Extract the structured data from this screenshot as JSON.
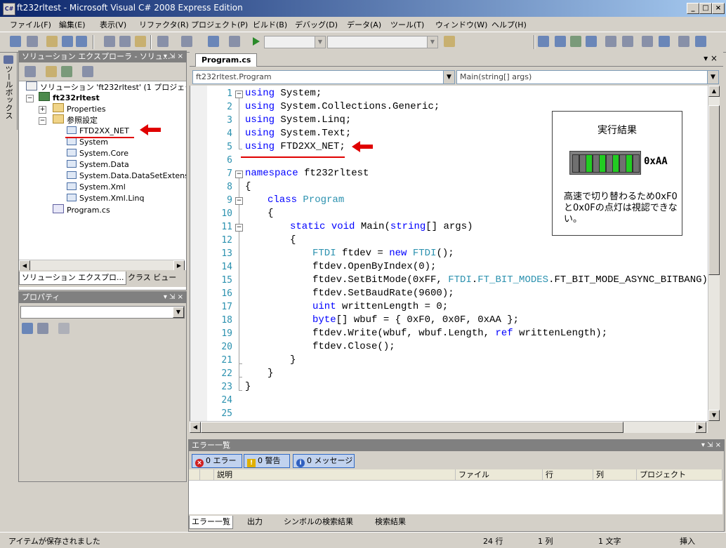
{
  "window": {
    "title": "ft232rltest - Microsoft Visual C# 2008 Express Edition",
    "icon_text": "C#",
    "minimize": "_",
    "maximize": "□",
    "close": "×"
  },
  "menu": [
    "ファイル(F)",
    "編集(E)",
    "表示(V)",
    "リファクタ(R)",
    "プロジェクト(P)",
    "ビルド(B)",
    "デバッグ(D)",
    "データ(A)",
    "ツール(T)",
    "ウィンドウ(W)",
    "ヘルプ(H)"
  ],
  "toolbox_label": "ツールボックス",
  "solution_explorer": {
    "title": "ソリューション エクスプローラ - ソリュ...",
    "header_buttons": "▾ ⇲ ×",
    "tree": {
      "solution": "ソリューション 'ft232rltest' (1 プロジェクト)",
      "project": "ft232rltest",
      "properties": "Properties",
      "references": "参照設定",
      "refs": [
        "FTD2XX_NET",
        "System",
        "System.Core",
        "System.Data",
        "System.Data.DataSetExtensions",
        "System.Xml",
        "System.Xml.Linq"
      ],
      "program_file": "Program.cs"
    },
    "tabs": [
      "ソリューション エクスプロ...",
      "クラス ビュー"
    ]
  },
  "properties_panel": {
    "title": "プロパティ",
    "header_buttons": "▾ ⇲ ×"
  },
  "editor": {
    "tab": "Program.cs",
    "tab_controls": "▾ ×",
    "nav_left": "ft232rltest.Program",
    "nav_right": "Main(string[] args)",
    "line_numbers": [
      "1",
      "2",
      "3",
      "4",
      "5",
      "6",
      "7",
      "8",
      "9",
      "10",
      "11",
      "12",
      "13",
      "14",
      "15",
      "16",
      "17",
      "18",
      "19",
      "20",
      "21",
      "22",
      "23",
      "24",
      "25"
    ],
    "code": {
      "l1_kw": "using",
      "l1_rest": " System;",
      "l2_kw": "using",
      "l2_rest": " System.Collections.Generic;",
      "l3_kw": "using",
      "l3_rest": " System.Linq;",
      "l4_kw": "using",
      "l4_rest": " System.Text;",
      "l5_kw": "using",
      "l5_rest": " FTD2XX_NET;",
      "l7_kw": "namespace",
      "l7_rest": " ft232rltest",
      "l8": "{",
      "l9_kw": "class",
      "l9_ty": "Program",
      "l10": "{",
      "l11_kw1": "static",
      "l11_kw2": "void",
      "l11_a": " Main(",
      "l11_kw3": "string",
      "l11_b": "[] args)",
      "l12": "{",
      "l13_ty1": "FTDI",
      "l13_a": " ftdev = ",
      "l13_kw": "new",
      "l13_ty2": "FTDI",
      "l13_b": "();",
      "l14": "ftdev.OpenByIndex(0);",
      "l15_a": "ftdev.SetBitMode(0xFF, ",
      "l15_ty1": "FTDI",
      "l15_dot": ".",
      "l15_ty2": "FT_BIT_MODES",
      "l15_b": ".FT_BIT_MODE_ASYNC_BITBANG);",
      "l16": "ftdev.SetBaudRate(9600);",
      "l17_kw": "uint",
      "l17_rest": " writtenLength = 0;",
      "l18_kw": "byte",
      "l18_rest": "[] wbuf = { 0xF0, 0x0F, 0xAA };",
      "l19_a": "ftdev.Write(wbuf, wbuf.Length, ",
      "l19_kw": "ref",
      "l19_b": " writtenLength);",
      "l20": "ftdev.Close();",
      "l21": "}",
      "l22": "}",
      "l23": "}"
    }
  },
  "result_box": {
    "title": "実行結果",
    "value": "0xAA",
    "note": "高速で切り替わるため0xF0と0x0Fの点灯は視認できない。",
    "leds": [
      false,
      false,
      true,
      false,
      true,
      false,
      true,
      false,
      true,
      false
    ],
    "led_on_color": "#22cc22",
    "led_off_color": "#707070"
  },
  "error_list": {
    "title": "エラー一覧",
    "errors": "0 エラー",
    "warnings": "0 警告",
    "messages": "0 メッセージ",
    "columns": [
      "説明",
      "ファイル",
      "行",
      "列",
      "プロジェクト"
    ],
    "tabs": [
      "エラー一覧",
      "出力",
      "シンボルの検索結果",
      "検索結果"
    ]
  },
  "status": {
    "message": "アイテムが保存されました",
    "line": "24 行",
    "col": "1 列",
    "char": "1 文字",
    "mode": "挿入"
  },
  "annotation_color": "#e00000"
}
